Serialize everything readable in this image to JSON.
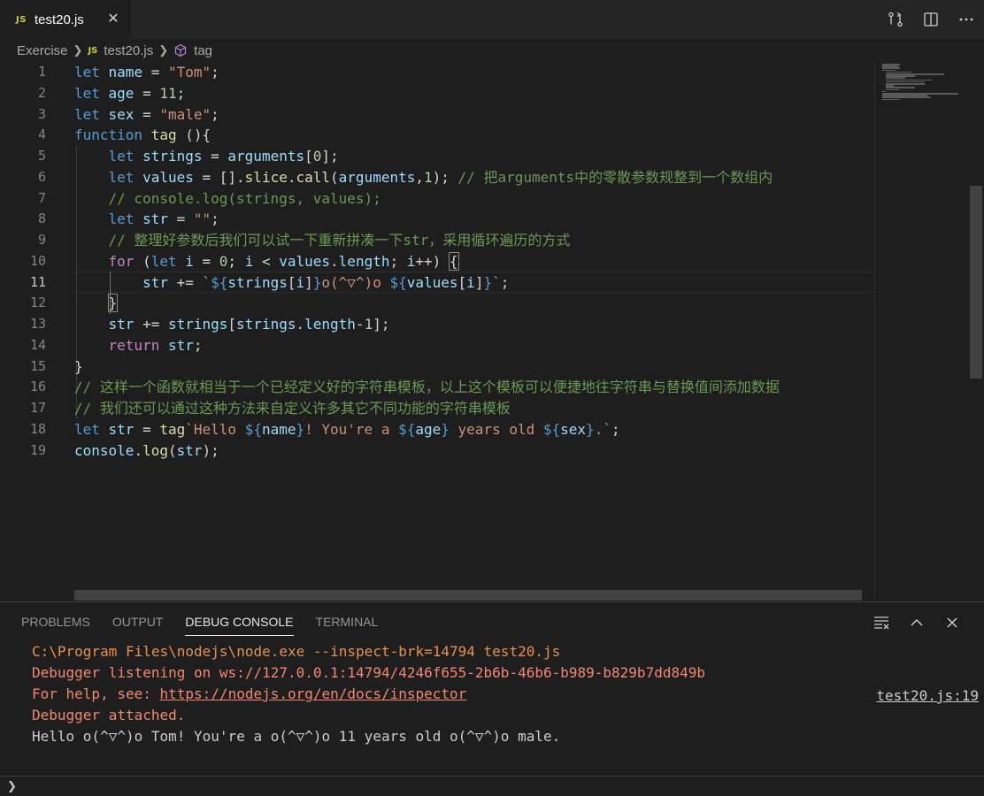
{
  "tab": {
    "badge": "JS",
    "title": "test20.js",
    "close": "✕"
  },
  "breadcrumb": {
    "folder": "Exercise",
    "file_badge": "JS",
    "file": "test20.js",
    "symbol": "tag"
  },
  "editor": {
    "line_numbers": [
      "1",
      "2",
      "3",
      "4",
      "5",
      "6",
      "7",
      "8",
      "9",
      "10",
      "11",
      "12",
      "13",
      "14",
      "15",
      "16",
      "17",
      "18",
      "19"
    ],
    "l1": [
      "let",
      " name ",
      "= ",
      "\"Tom\"",
      ";"
    ],
    "l2": [
      "let",
      " age ",
      "= ",
      "11",
      ";"
    ],
    "l3": [
      "let",
      " sex ",
      "= ",
      "\"male\"",
      ";"
    ],
    "l4": [
      "function",
      " tag ",
      "(){"
    ],
    "l5": [
      "    ",
      "let",
      " strings ",
      "= ",
      "arguments",
      "[",
      "0",
      "];"
    ],
    "l6": [
      "    ",
      "let",
      " values ",
      "= [].",
      "slice",
      ".",
      "call",
      "(",
      "arguments",
      ",",
      "1",
      "); ",
      "// 把arguments中的零散参数规整到一个数组内"
    ],
    "l7": [
      "    ",
      "// console.log(strings, values);"
    ],
    "l8": [
      "    ",
      "let",
      " str ",
      "= ",
      "\"\"",
      ";"
    ],
    "l9": [
      "    ",
      "// 整理好参数后我们可以试一下重新拼凑一下str，采用循环遍历的方式"
    ],
    "l10": [
      "    ",
      "for",
      " (",
      "let",
      " i ",
      "= ",
      "0",
      "; ",
      "i",
      " < ",
      "values",
      ".",
      "length",
      "; ",
      "i",
      "++) ",
      "{"
    ],
    "l11": [
      "        ",
      "str",
      " += ",
      "`",
      "${",
      "strings",
      "[",
      "i",
      "]",
      "}",
      "o(^▽^)o ",
      "${",
      "values",
      "[",
      "i",
      "]",
      "}",
      "`",
      ";"
    ],
    "l12": [
      "    ",
      "}"
    ],
    "l13": [
      "    ",
      "str",
      " += ",
      "strings",
      "[",
      "strings",
      ".",
      "length",
      "-",
      "1",
      "];"
    ],
    "l14": [
      "    ",
      "return",
      " ",
      "str",
      ";"
    ],
    "l15": [
      "}"
    ],
    "l16": [
      "// 这样一个函数就相当于一个已经定义好的字符串模板，以上这个模板可以便捷地往字符串与替换值间添加数据"
    ],
    "l17": [
      "// 我们还可以通过这种方法来自定义许多其它不同功能的字符串模板"
    ],
    "l18": [
      "let",
      " str ",
      "= ",
      "tag",
      "`Hello ",
      "${",
      "name",
      "}",
      "! You're a ",
      "${",
      "age",
      "}",
      " years old ",
      "${",
      "sex",
      "}",
      ".`",
      ";"
    ],
    "l19": [
      "console",
      ".",
      "log",
      "(",
      "str",
      ");"
    ]
  },
  "panel": {
    "tabs": [
      "PROBLEMS",
      "OUTPUT",
      "DEBUG CONSOLE",
      "TERMINAL"
    ],
    "console": {
      "cmd": "C:\\Program Files\\nodejs\\node.exe --inspect-brk=14794 test20.js",
      "listening": "Debugger listening on ws://127.0.0.1:14794/4246f655-2b6b-46b6-b989-b829b7dd849b",
      "help_prefix": "For help, see: ",
      "help_link": "https://nodejs.org/en/docs/inspector",
      "attached": "Debugger attached.",
      "output": "Hello o(^▽^)o Tom! You're a o(^▽^)o 11 years old o(^▽^)o male.",
      "source": "test20.js:19"
    },
    "prompt": "❯"
  },
  "colors": {
    "keyword": "#569cd6",
    "control": "#c586c0",
    "variable": "#9cdcfe",
    "string": "#ce9178",
    "number": "#b5cea8",
    "function": "#dcdcaa",
    "comment": "#6a9955",
    "error_text": "#f48771"
  }
}
